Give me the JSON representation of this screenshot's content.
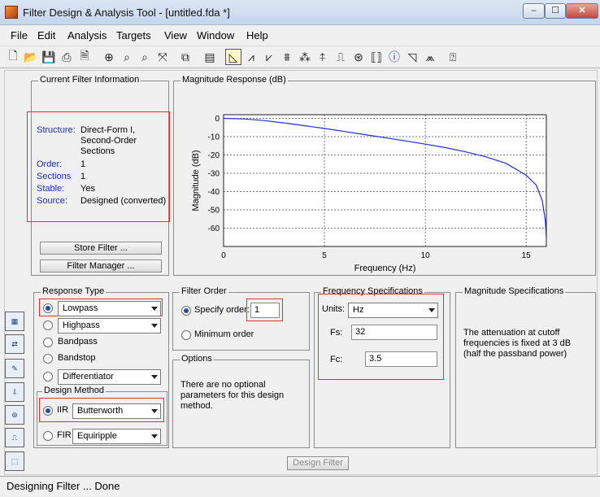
{
  "window": {
    "title": "Filter Design & Analysis Tool -  [untitled.fda *]",
    "min": "‒",
    "max": "☐",
    "close": "✕"
  },
  "menu": [
    "File",
    "Edit",
    "Analysis",
    "Targets",
    "View",
    "Window",
    "Help"
  ],
  "toolbar_icons": [
    "new-icon",
    "open-icon",
    "save-icon",
    "print-icon",
    "print-preview-icon",
    "zoom-in-icon",
    "zoom-x-icon",
    "zoom-y-icon",
    "full-view-icon",
    "new-figure-icon",
    "filter-specs-icon",
    "magnitude-response-icon",
    "phase-response-icon",
    "magnitude-phase-icon",
    "group-delay-icon",
    "phase-delay-icon",
    "impulse-response-icon",
    "step-response-icon",
    "pole-zero-icon",
    "coefficients-icon",
    "info-icon",
    "round-off-noise-icon",
    "magnitude-estimate-icon",
    "whats-this-icon"
  ],
  "current_filter": {
    "title": "Current Filter Information",
    "rows": [
      {
        "label": "Structure:",
        "value": "Direct-Form I,\nSecond-Order\nSections"
      },
      {
        "label": "Order:",
        "value": "1"
      },
      {
        "label": "Sections",
        "value": "1"
      },
      {
        "label": "Stable:",
        "value": "Yes"
      },
      {
        "label": "Source:",
        "value": "Designed (converted)"
      }
    ],
    "store_button": "Store Filter ...",
    "manager_button": "Filter Manager ..."
  },
  "magnitude_panel": {
    "title": "Magnitude Response (dB)"
  },
  "chart_data": {
    "type": "line",
    "title": "",
    "xlabel": "Frequency (Hz)",
    "ylabel": "Magnitude (dB)",
    "xlim": [
      0,
      16
    ],
    "ylim": [
      -70,
      2
    ],
    "xticks": [
      0,
      5,
      10,
      15
    ],
    "yticks": [
      0,
      -10,
      -20,
      -30,
      -40,
      -50,
      -60
    ],
    "grid": true,
    "series": [
      {
        "color": "#1f2ee0",
        "x": [
          0,
          1,
          2,
          3,
          4,
          5,
          6,
          7,
          8,
          9,
          10,
          11,
          12,
          13,
          14,
          15,
          15.5,
          15.8,
          15.95,
          16.0
        ],
        "y": [
          0,
          -0.3,
          -1.2,
          -2.5,
          -4.0,
          -5.5,
          -7.2,
          -8.9,
          -10.6,
          -12.3,
          -14.1,
          -16.0,
          -18.3,
          -21.0,
          -24.6,
          -31.0,
          -36.5,
          -45.0,
          -56.0,
          -66.0
        ]
      }
    ]
  },
  "response_type": {
    "title": "Response Type",
    "lowpass": "Lowpass",
    "highpass": "Highpass",
    "bandpass": "Bandpass",
    "bandstop": "Bandstop",
    "differentiator": "Differentiator"
  },
  "design_method": {
    "title": "Design Method",
    "iir_label": "IIR",
    "iir_value": "Butterworth",
    "fir_label": "FIR",
    "fir_value": "Equiripple"
  },
  "filter_order": {
    "title": "Filter Order",
    "specify_label": "Specify order:",
    "specify_value": "1",
    "minimum_label": "Minimum order"
  },
  "options": {
    "title": "Options",
    "text": "There are no optional\nparameters for this design\nmethod."
  },
  "freq_specs": {
    "title": "Frequency Specifications",
    "units_label": "Units:",
    "units_value": "Hz",
    "fs_label": "Fs:",
    "fs_value": "32",
    "fc_label": "Fc:",
    "fc_value": "3.5"
  },
  "mag_specs": {
    "title": "Magnitude Specifications",
    "text": "The attenuation at cutoff\nfrequencies is fixed at 3 dB\n(half the passband power)"
  },
  "design_button": "Design Filter",
  "status": "Designing Filter ... Done"
}
